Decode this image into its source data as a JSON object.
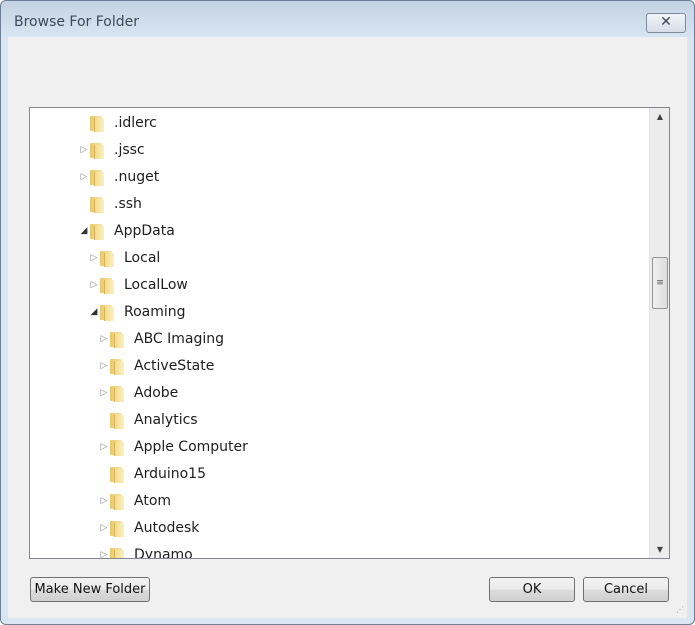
{
  "window": {
    "title": "Browse For Folder",
    "close_glyph": "✕"
  },
  "tree": {
    "items": [
      {
        "label": ".idlerc",
        "level": 0,
        "expander": "none"
      },
      {
        "label": ".jssc",
        "level": 0,
        "expander": "collapsed"
      },
      {
        "label": ".nuget",
        "level": 0,
        "expander": "collapsed"
      },
      {
        "label": ".ssh",
        "level": 0,
        "expander": "none"
      },
      {
        "label": "AppData",
        "level": 0,
        "expander": "expanded"
      },
      {
        "label": "Local",
        "level": 1,
        "expander": "collapsed"
      },
      {
        "label": "LocalLow",
        "level": 1,
        "expander": "collapsed"
      },
      {
        "label": "Roaming",
        "level": 1,
        "expander": "expanded"
      },
      {
        "label": "ABC Imaging",
        "level": 2,
        "expander": "collapsed"
      },
      {
        "label": "ActiveState",
        "level": 2,
        "expander": "collapsed"
      },
      {
        "label": "Adobe",
        "level": 2,
        "expander": "collapsed"
      },
      {
        "label": "Analytics",
        "level": 2,
        "expander": "none"
      },
      {
        "label": "Apple Computer",
        "level": 2,
        "expander": "collapsed"
      },
      {
        "label": "Arduino15",
        "level": 2,
        "expander": "none"
      },
      {
        "label": "Atom",
        "level": 2,
        "expander": "collapsed"
      },
      {
        "label": "Autodesk",
        "level": 2,
        "expander": "collapsed"
      },
      {
        "label": "Dynamo",
        "level": 2,
        "expander": "collapsed"
      }
    ],
    "scroll_position_fraction": 0.38
  },
  "buttons": {
    "new_folder": "Make New Folder",
    "ok": "OK",
    "cancel": "Cancel"
  }
}
